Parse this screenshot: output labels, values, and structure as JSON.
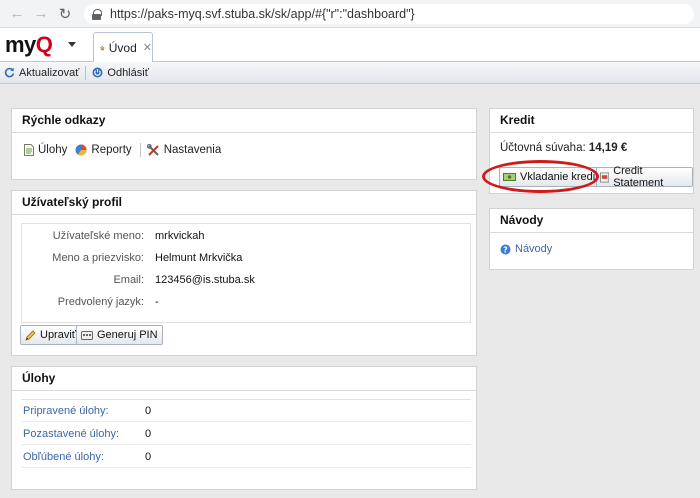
{
  "browser": {
    "url": "https://paks-myq.svf.stuba.sk/sk/app/#{\"r\":\"dashboard\"}"
  },
  "app": {
    "logo_text": "my",
    "logo_accent": "Q",
    "brand_color": "#d0021b",
    "tab_label": "Úvod"
  },
  "toolbar": {
    "refresh_label": "Aktualizovať",
    "logout_label": "Odhlásiť"
  },
  "quick_links": {
    "title": "Rýchle odkazy",
    "tasks_label": "Úlohy",
    "reports_label": "Reporty",
    "settings_label": "Nastavenia"
  },
  "profile": {
    "title": "Užívateľský profil",
    "fields": [
      {
        "label": "Užívateľské meno:",
        "value": "mrkvickah"
      },
      {
        "label": "Meno a priezvisko:",
        "value": "Helmunt Mrkvička"
      },
      {
        "label": "Email:",
        "value": "123456@is.stuba.sk"
      },
      {
        "label": "Predvolený jazyk:",
        "value": "-"
      }
    ],
    "edit_label": "Upraviť",
    "pin_label": "Generuj PIN"
  },
  "tasks": {
    "title": "Úlohy",
    "rows": [
      {
        "label": "Pripravené úlohy:",
        "value": "0"
      },
      {
        "label": "Pozastavené úlohy:",
        "value": "0"
      },
      {
        "label": "Obľúbené úlohy:",
        "value": "0"
      }
    ]
  },
  "credit": {
    "title": "Kredit",
    "balance_label": "Účtovná súvaha:",
    "balance_value": "14,19 €",
    "deposit_label": "Vkladanie kreditu",
    "statement_label": "Credit Statement",
    "highlight_color": "#d01a1a"
  },
  "guides": {
    "title": "Návody",
    "link_label": "Návody"
  }
}
